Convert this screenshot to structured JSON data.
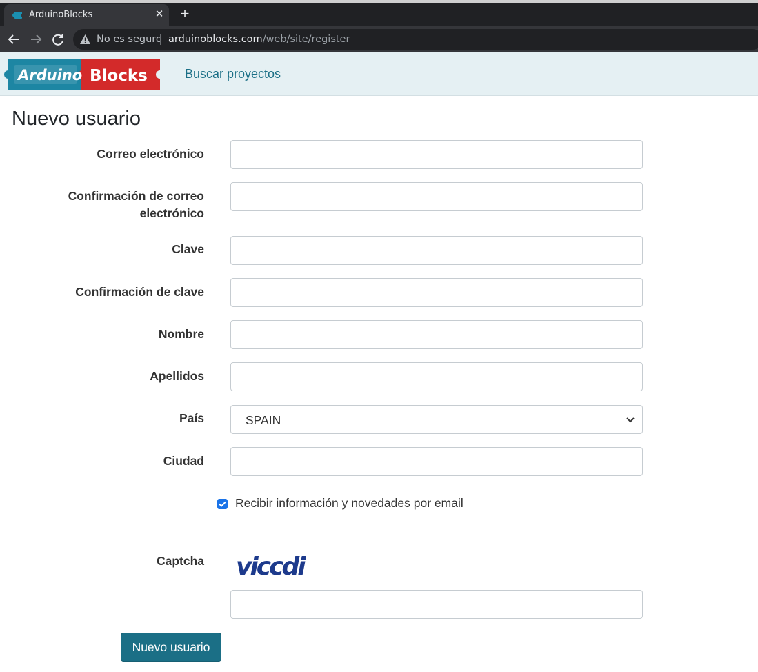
{
  "browser": {
    "tab_title": "ArduinoBlocks",
    "security_text": "No es seguro",
    "url_host": "arduinoblocks.com",
    "url_path": "/web/site/register"
  },
  "nav": {
    "logo_alt": "ArduinoBlocks",
    "search_link": "Buscar proyectos"
  },
  "form": {
    "title": "Nuevo usuario",
    "fields": {
      "email": {
        "label": "Correo electrónico",
        "value": ""
      },
      "email_confirm": {
        "label_line1": "Confirmación de correo",
        "label_line2": "electrónico",
        "value": ""
      },
      "password": {
        "label": "Clave",
        "value": ""
      },
      "password_confirm": {
        "label": "Confirmación de clave",
        "value": ""
      },
      "name": {
        "label": "Nombre",
        "value": ""
      },
      "surname": {
        "label": "Apellidos",
        "value": ""
      },
      "country": {
        "label": "País",
        "selected": "SPAIN"
      },
      "city": {
        "label": "Ciudad",
        "value": ""
      },
      "newsletter": {
        "label": "Recibir información y novedades por email",
        "checked": true
      },
      "captcha": {
        "label": "Captcha",
        "image_text": "viccdi",
        "value": ""
      }
    },
    "submit_label": "Nuevo usuario"
  },
  "colors": {
    "accent": "#1b6f86",
    "nav_background": "#e5f0f3",
    "checkbox": "#1a73e8"
  },
  "icons": {
    "favicon": "arduinoblocks-favicon-icon",
    "warning": "warning-triangle-icon",
    "back": "arrow-left-icon",
    "forward": "arrow-right-icon",
    "reload": "reload-icon",
    "close": "close-icon",
    "new_tab": "plus-icon",
    "select": "chevron-down-icon",
    "checkbox": "checkmark-icon"
  }
}
